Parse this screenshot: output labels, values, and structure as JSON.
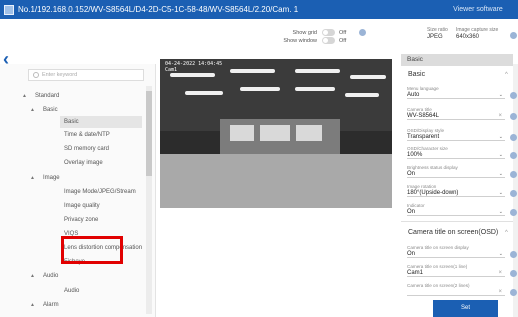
{
  "window": {
    "title": "No.1/192.168.0.152/WV-S8564L/D4-2D-C5-1C-58-48/WV-S8564L/2.20/Cam. 1",
    "software_label": "Viewer software"
  },
  "topbar": {
    "show_grid_label": "Show grid",
    "show_grid_state": "Off",
    "show_window_label": "Show window",
    "show_window_state": "Off",
    "size_label": "Size ratio",
    "size_value": "JPEG",
    "capture_label": "Image capture size",
    "capture_value": "640x360"
  },
  "nav": {
    "back_icon": "back-arrow-icon"
  },
  "tree": {
    "search_placeholder": "Enter keyword",
    "items": [
      {
        "label": "Standard",
        "caret": "◄"
      },
      {
        "label": "Basic",
        "caret": "▲"
      },
      {
        "label": "Basic"
      },
      {
        "label": "Time & date/NTP"
      },
      {
        "label": "SD memory card"
      },
      {
        "label": "Overlay image"
      },
      {
        "label": "Image",
        "caret": "▲"
      },
      {
        "label": "Image Mode/JPEG/Stream"
      },
      {
        "label": "Image quality"
      },
      {
        "label": "Privacy zone"
      },
      {
        "label": "VIQS"
      },
      {
        "label": "Lens distortion compensation"
      },
      {
        "label": "Fisheye"
      },
      {
        "label": "Audio",
        "caret": "▲"
      },
      {
        "label": "Audio"
      },
      {
        "label": "Alarm",
        "caret": "▲"
      }
    ]
  },
  "video": {
    "osd_datetime": "04-24-2022 14:04:45",
    "osd_title": "Cam1"
  },
  "right": {
    "header": "Basic",
    "section1_title": "Basic",
    "fields": [
      {
        "label": "Menu language",
        "value": "Auto",
        "kind": "dropdown"
      },
      {
        "label": "Camera title",
        "value": "WV-S8564L",
        "kind": "text"
      },
      {
        "label": "OSD/Display style",
        "value": "Transparent",
        "kind": "dropdown"
      },
      {
        "label": "OSD/Character size",
        "value": "100%",
        "kind": "dropdown"
      },
      {
        "label": "Brightness status display",
        "value": "On",
        "kind": "dropdown"
      },
      {
        "label": "Image rotation",
        "value": "180°(Upside-down)",
        "kind": "dropdown"
      },
      {
        "label": "Indicator",
        "value": "On",
        "kind": "dropdown"
      }
    ],
    "section2_title": "Camera title on screen(OSD)",
    "osd_fields": [
      {
        "label": "Camera title on screen display",
        "value": "On",
        "kind": "dropdown"
      },
      {
        "label": "Camera title on screen(1 line)",
        "value": "Cam1",
        "kind": "text"
      },
      {
        "label": "Camera title on screen(2 lines)",
        "value": "",
        "kind": "text"
      }
    ],
    "set_button": "Set"
  },
  "colors": {
    "titlebar": "#1b5fb3",
    "highlight": "#e10000",
    "help_dot": "#9bb4d6"
  }
}
